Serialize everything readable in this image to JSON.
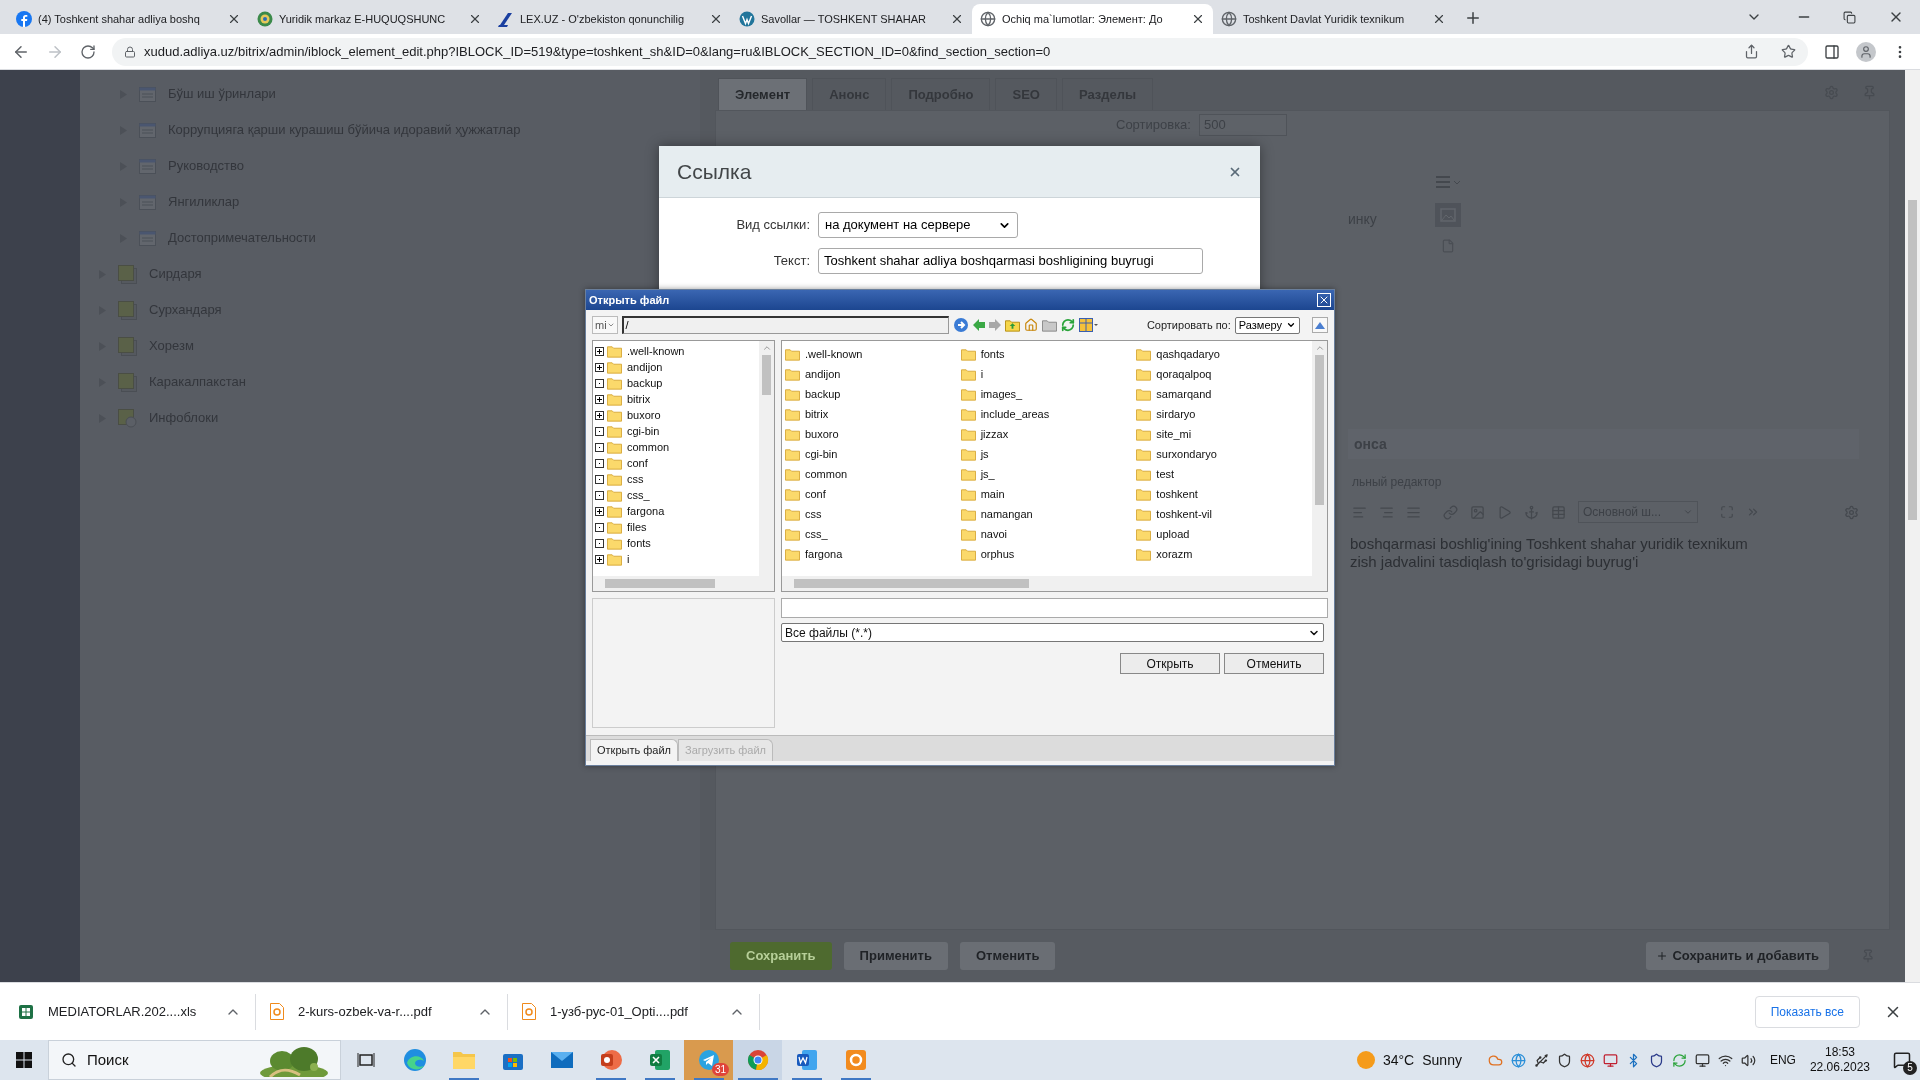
{
  "browser": {
    "tabs": [
      {
        "title": "(4) Toshkent shahar adliya boshq",
        "kind": "facebook",
        "selected": false
      },
      {
        "title": "Yuridik markaz E-HUQUQSHUNC",
        "kind": "emblem",
        "selected": false
      },
      {
        "title": "LEX.UZ - O'zbekiston qonunchilig",
        "kind": "lex",
        "selected": false
      },
      {
        "title": "Savollar — TOSHKENT SHAHAR",
        "kind": "wordpress",
        "selected": false
      },
      {
        "title": "Ochiq ma`lumotlar: Элемент: До",
        "kind": "globe",
        "selected": true
      },
      {
        "title": "Toshkent Davlat Yuridik texnikum",
        "kind": "globe",
        "selected": false
      }
    ],
    "address": "xudud.adliya.uz/bitrix/admin/iblock_element_edit.php?IBLOCK_ID=519&type=toshkent_sh&ID=0&lang=ru&IBLOCK_SECTION_ID=0&find_section_section=0"
  },
  "sidebar": {
    "items": [
      {
        "label": "Бўш иш ўринлари",
        "kind": "subsection"
      },
      {
        "label": "Коррупцияга қарши курашиш бўйича идоравий ҳужжатлар",
        "kind": "subsection"
      },
      {
        "label": "Руководство",
        "kind": "subsection"
      },
      {
        "label": "Янгиликлар",
        "kind": "subsection"
      },
      {
        "label": "Достопримечательности",
        "kind": "subsection"
      },
      {
        "label": "Сирдаря",
        "kind": "section"
      },
      {
        "label": "Сурхандаря",
        "kind": "section"
      },
      {
        "label": "Хорезм",
        "kind": "section"
      },
      {
        "label": "Каракалпакстан",
        "kind": "section"
      },
      {
        "label": "Инфоблоки",
        "kind": "infoblock"
      }
    ]
  },
  "editor": {
    "tabs": [
      {
        "label": "Элемент",
        "selected": true
      },
      {
        "label": "Анонс",
        "selected": false
      },
      {
        "label": "Подробно",
        "selected": false
      },
      {
        "label": "SEO",
        "selected": false
      },
      {
        "label": "Разделы",
        "selected": false
      }
    ],
    "sort_label": "Сортировка:",
    "sort_value": "500",
    "upload_hint": "инку",
    "section_title": "онса",
    "editor_mode": "льный редактор",
    "style_select": "Основной ш...",
    "text_lines": [
      "boshqarmasi boshlig'ining Toshkent shahar yuridik texnikum",
      "zish jadvalini tasdiqlash to'grisidagi buyrug'i"
    ],
    "buttons": [
      {
        "label": "Сохранить",
        "kind": "primary"
      },
      {
        "label": "Применить",
        "kind": "normal"
      },
      {
        "label": "Отменить",
        "kind": "normal"
      }
    ],
    "save_add": "Сохранить и добавить"
  },
  "link_dialog": {
    "title": "Ссылка",
    "fields": [
      {
        "label": "Вид ссылки:",
        "kind": "select",
        "value": "на документ на сервере"
      },
      {
        "label": "Текст:",
        "kind": "input",
        "value": "Toshkent shahar adliya boshqarmasi boshligining buyrugi"
      }
    ]
  },
  "file_dialog": {
    "title": "Открыть файл",
    "site": "mi",
    "path": "/",
    "sort_label": "Сортировать по:",
    "sort_value": "Размеру",
    "tree": [
      {
        "name": ".well-known",
        "expandable": true
      },
      {
        "name": "andijon",
        "expandable": true
      },
      {
        "name": "backup",
        "expandable": false
      },
      {
        "name": "bitrix",
        "expandable": true
      },
      {
        "name": "buxoro",
        "expandable": true
      },
      {
        "name": "cgi-bin",
        "expandable": false
      },
      {
        "name": "common",
        "expandable": false
      },
      {
        "name": "conf",
        "expandable": false
      },
      {
        "name": "css",
        "expandable": false
      },
      {
        "name": "css_",
        "expandable": false
      },
      {
        "name": "fargona",
        "expandable": true
      },
      {
        "name": "files",
        "expandable": false
      },
      {
        "name": "fonts",
        "expandable": false
      },
      {
        "name": "i",
        "expandable": true
      }
    ],
    "files": [
      ".well-known",
      "andijon",
      "backup",
      "bitrix",
      "buxoro",
      "cgi-bin",
      "common",
      "conf",
      "css",
      "css_",
      "fargona",
      "fonts",
      "i",
      "images_",
      "include_areas",
      "jizzax",
      "js",
      "js_",
      "main",
      "namangan",
      "navoi",
      "orphus",
      "qashqadaryo",
      "qoraqalpoq",
      "samarqand",
      "sirdaryo",
      "site_mi",
      "surxondaryo",
      "test",
      "toshkent",
      "toshkent-vil",
      "upload",
      "xorazm"
    ],
    "filter": "Все файлы (*.*)",
    "buttons": [
      "Открыть",
      "Отменить"
    ],
    "tabs": [
      {
        "label": "Открыть файл",
        "selected": true
      },
      {
        "label": "Загрузить файл",
        "selected": false
      }
    ]
  },
  "downloads": {
    "items": [
      {
        "name": "MEDIATORLAR.202....xls",
        "kind": "xls"
      },
      {
        "name": "2-kurs-ozbek-va-r....pdf",
        "kind": "pdf"
      },
      {
        "name": "1-узб-рус-01_Opti....pdf",
        "kind": "pdf"
      }
    ],
    "show_all": "Показать все"
  },
  "taskbar": {
    "search": "Поиск",
    "apps": [
      {
        "kind": "taskview",
        "running": false,
        "selected": false,
        "flashing": false
      },
      {
        "kind": "edge",
        "running": false,
        "selected": false,
        "flashing": false
      },
      {
        "kind": "explorer",
        "running": true,
        "selected": false,
        "flashing": false
      },
      {
        "kind": "store",
        "running": false,
        "selected": false,
        "flashing": false
      },
      {
        "kind": "mail",
        "running": false,
        "selected": false,
        "flashing": false
      },
      {
        "kind": "powerpoint",
        "running": true,
        "selected": false,
        "flashing": false
      },
      {
        "kind": "excel",
        "running": true,
        "selected": false,
        "flashing": false
      },
      {
        "kind": "telegram",
        "running": true,
        "selected": false,
        "flashing": true,
        "badge": "31"
      },
      {
        "kind": "chrome",
        "running": true,
        "selected": true,
        "flashing": false
      },
      {
        "kind": "word",
        "running": true,
        "selected": false,
        "flashing": false
      },
      {
        "kind": "reader",
        "running": true,
        "selected": false,
        "flashing": false
      }
    ],
    "temperature": "34°C",
    "weather": "Sunny",
    "language": "ENG",
    "time": "18:53",
    "date": "22.06.2023",
    "notifications": "5"
  }
}
